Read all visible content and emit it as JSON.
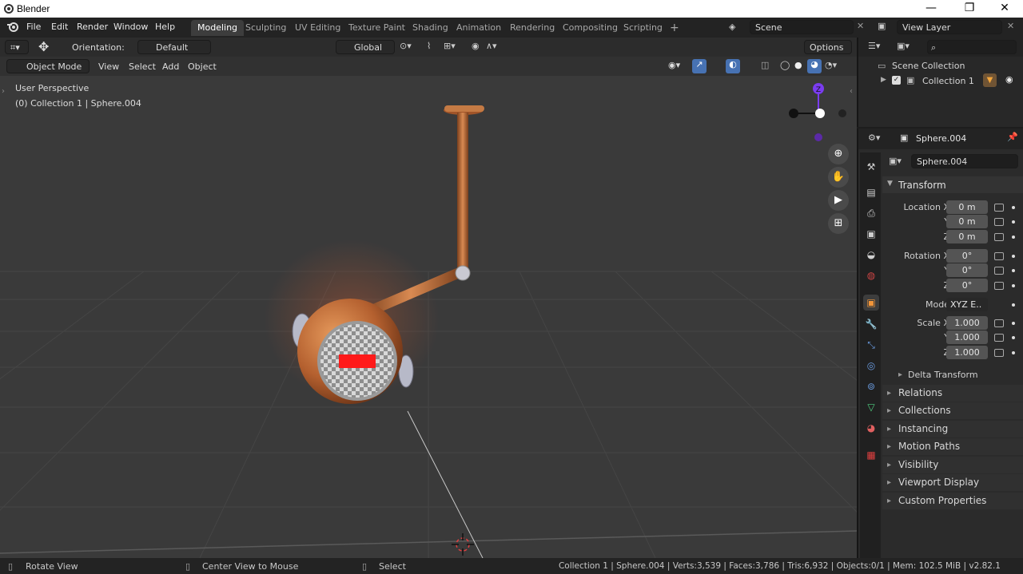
{
  "titlebar": {
    "title": "Blender",
    "minimize": "—",
    "maximize": "❐",
    "close": "✕"
  },
  "menubar": {
    "items": [
      "File",
      "Edit",
      "Render",
      "Window",
      "Help"
    ]
  },
  "workspaces": {
    "tabs": [
      "Modeling",
      "Sculpting",
      "UV Editing",
      "Texture Paint",
      "Shading",
      "Animation",
      "Rendering",
      "Compositing",
      "Scripting"
    ],
    "active": "Modeling",
    "add": "+"
  },
  "scene": {
    "scene_name": "Scene",
    "view_layer": "View Layer"
  },
  "tool_header": {
    "orientation_label": "Orientation:",
    "orientation_value": "Default",
    "transform_orientation": "Global",
    "options": "Options"
  },
  "viewport_header": {
    "mode": "Object Mode",
    "menus": [
      "View",
      "Select",
      "Add",
      "Object"
    ]
  },
  "viewport": {
    "perspective": "User Perspective",
    "context": "(0) Collection 1 | Sphere.004"
  },
  "gizmo": {
    "z_axis": "Z"
  },
  "outliner": {
    "root": "Scene Collection",
    "collection": "Collection 1"
  },
  "properties": {
    "object_name": "Sphere.004",
    "name_field": "Sphere.004",
    "transform_header": "Transform",
    "location_label": "Location X",
    "location": [
      "0 m",
      "0 m",
      "0 m"
    ],
    "rotation_label": "Rotation X",
    "rotation": [
      "0°",
      "0°",
      "0°"
    ],
    "axis_y": "Y",
    "axis_z": "Z",
    "mode_label": "Mode",
    "mode_value": "XYZ E..",
    "scale_label": "Scale X",
    "scale": [
      "1.000",
      "1.000",
      "1.000"
    ],
    "delta": "Delta Transform",
    "panels": [
      "Relations",
      "Collections",
      "Instancing",
      "Motion Paths",
      "Visibility",
      "Viewport Display",
      "Custom Properties"
    ]
  },
  "statusbar": {
    "left": "Rotate View",
    "middle": "Center View to Mouse",
    "right": "Select",
    "stats": "Collection 1 | Sphere.004 | Verts:3,539 | Faces:3,786 | Tris:6,932 | Objects:0/1 | Mem: 102.5 MiB | v2.82.1"
  },
  "colors": {
    "accent": "#4772b3",
    "emission": "#ff1a1a",
    "copper": "#b8683a",
    "gizmo_z": "#7a3cf0"
  }
}
